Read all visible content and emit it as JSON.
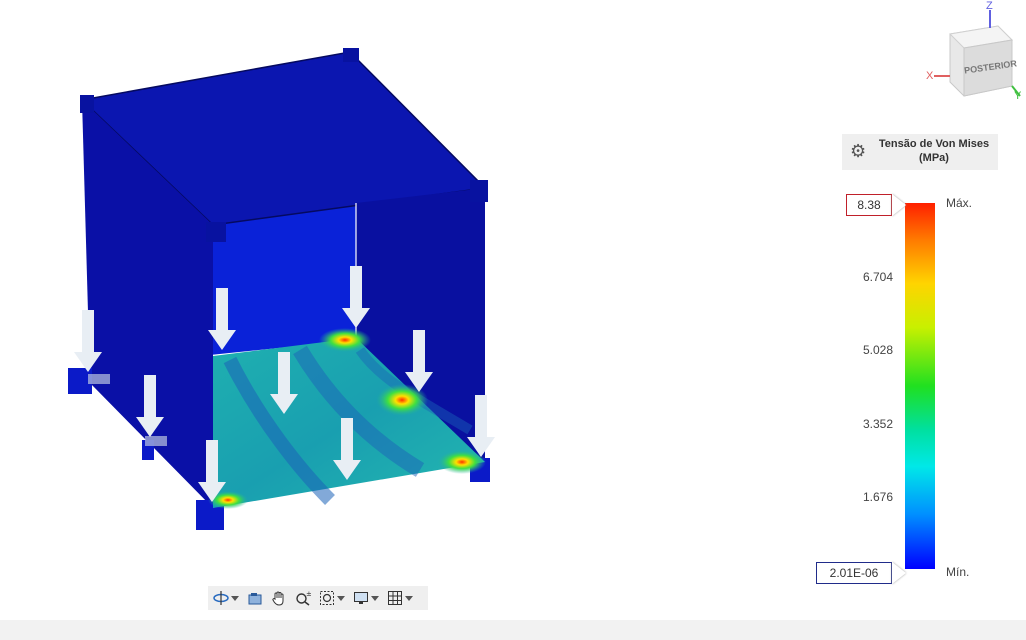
{
  "legend": {
    "title_line1": "Tensão de Von Mises",
    "title_line2": "(MPa)",
    "max_value": "8.38",
    "min_value": "2.01E-06",
    "max_label": "Máx.",
    "min_label": "Mín.",
    "ticks": [
      "6.704",
      "5.028",
      "3.352",
      "1.676"
    ],
    "gear_icon": "gear-icon",
    "colors": {
      "max": "#ff2000",
      "min": "#0000ff",
      "max_border": "#c0202a",
      "min_border": "#202c8a"
    }
  },
  "viewcube": {
    "face_label": "POSTERIOR",
    "axis_x": "X",
    "axis_y": "Y",
    "axis_z": "Z",
    "colors": {
      "x": "#e06060",
      "y": "#40c040",
      "z": "#6060e0"
    }
  },
  "toolbar": {
    "items": [
      {
        "icon": "orbit-icon",
        "dropdown": true
      },
      {
        "icon": "look-at-icon",
        "dropdown": false
      },
      {
        "icon": "pan-hand-icon",
        "dropdown": false
      },
      {
        "icon": "zoom-icon",
        "dropdown": false
      },
      {
        "icon": "zoom-window-icon",
        "dropdown": true
      },
      {
        "icon": "display-settings-icon",
        "dropdown": true
      },
      {
        "icon": "grid-icon",
        "dropdown": true
      }
    ]
  },
  "model": {
    "frame_color": "#0a14c8",
    "plate_color": "#1aa7a8"
  }
}
